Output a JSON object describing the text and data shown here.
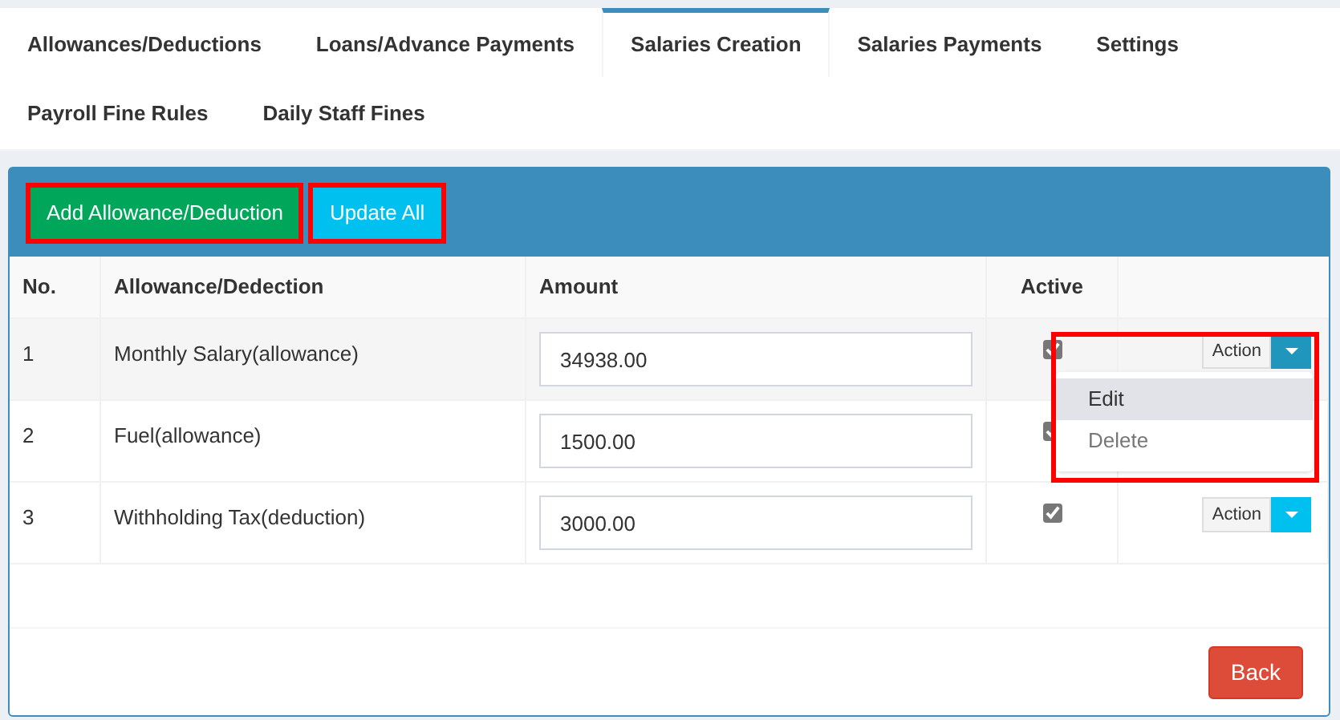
{
  "tabs": [
    {
      "label": "Allowances/Deductions",
      "selected": false
    },
    {
      "label": "Loans/Advance Payments",
      "selected": false
    },
    {
      "label": "Salaries Creation",
      "selected": true
    },
    {
      "label": "Salaries Payments",
      "selected": false
    },
    {
      "label": "Settings",
      "selected": false
    },
    {
      "label": "Payroll Fine Rules",
      "selected": false
    },
    {
      "label": "Daily Staff Fines",
      "selected": false
    }
  ],
  "toolbar": [
    {
      "label": "Add Allowance/Deduction",
      "kind": "success",
      "highlighted": true
    },
    {
      "label": "Update All",
      "kind": "info",
      "highlighted": true
    }
  ],
  "table": {
    "columns": [
      "No.",
      "Allowance/Dedection",
      "Amount",
      "Active"
    ],
    "rows": [
      {
        "no": "1",
        "name": "Monthly Salary(allowance)",
        "amount": "34938.00",
        "active": true,
        "action": "Action",
        "menu_open": true
      },
      {
        "no": "2",
        "name": "Fuel(allowance)",
        "amount": "1500.00",
        "active": true
      },
      {
        "no": "3",
        "name": "Withholding Tax(deduction)",
        "amount": "3000.00",
        "active": true,
        "action": "Action",
        "menu_open": false
      }
    ]
  },
  "action_menu": {
    "highlighted": true,
    "items": [
      {
        "label": "Edit",
        "selected": true
      },
      {
        "label": "Delete",
        "selected": false
      }
    ]
  },
  "footer": {
    "back": "Back"
  }
}
